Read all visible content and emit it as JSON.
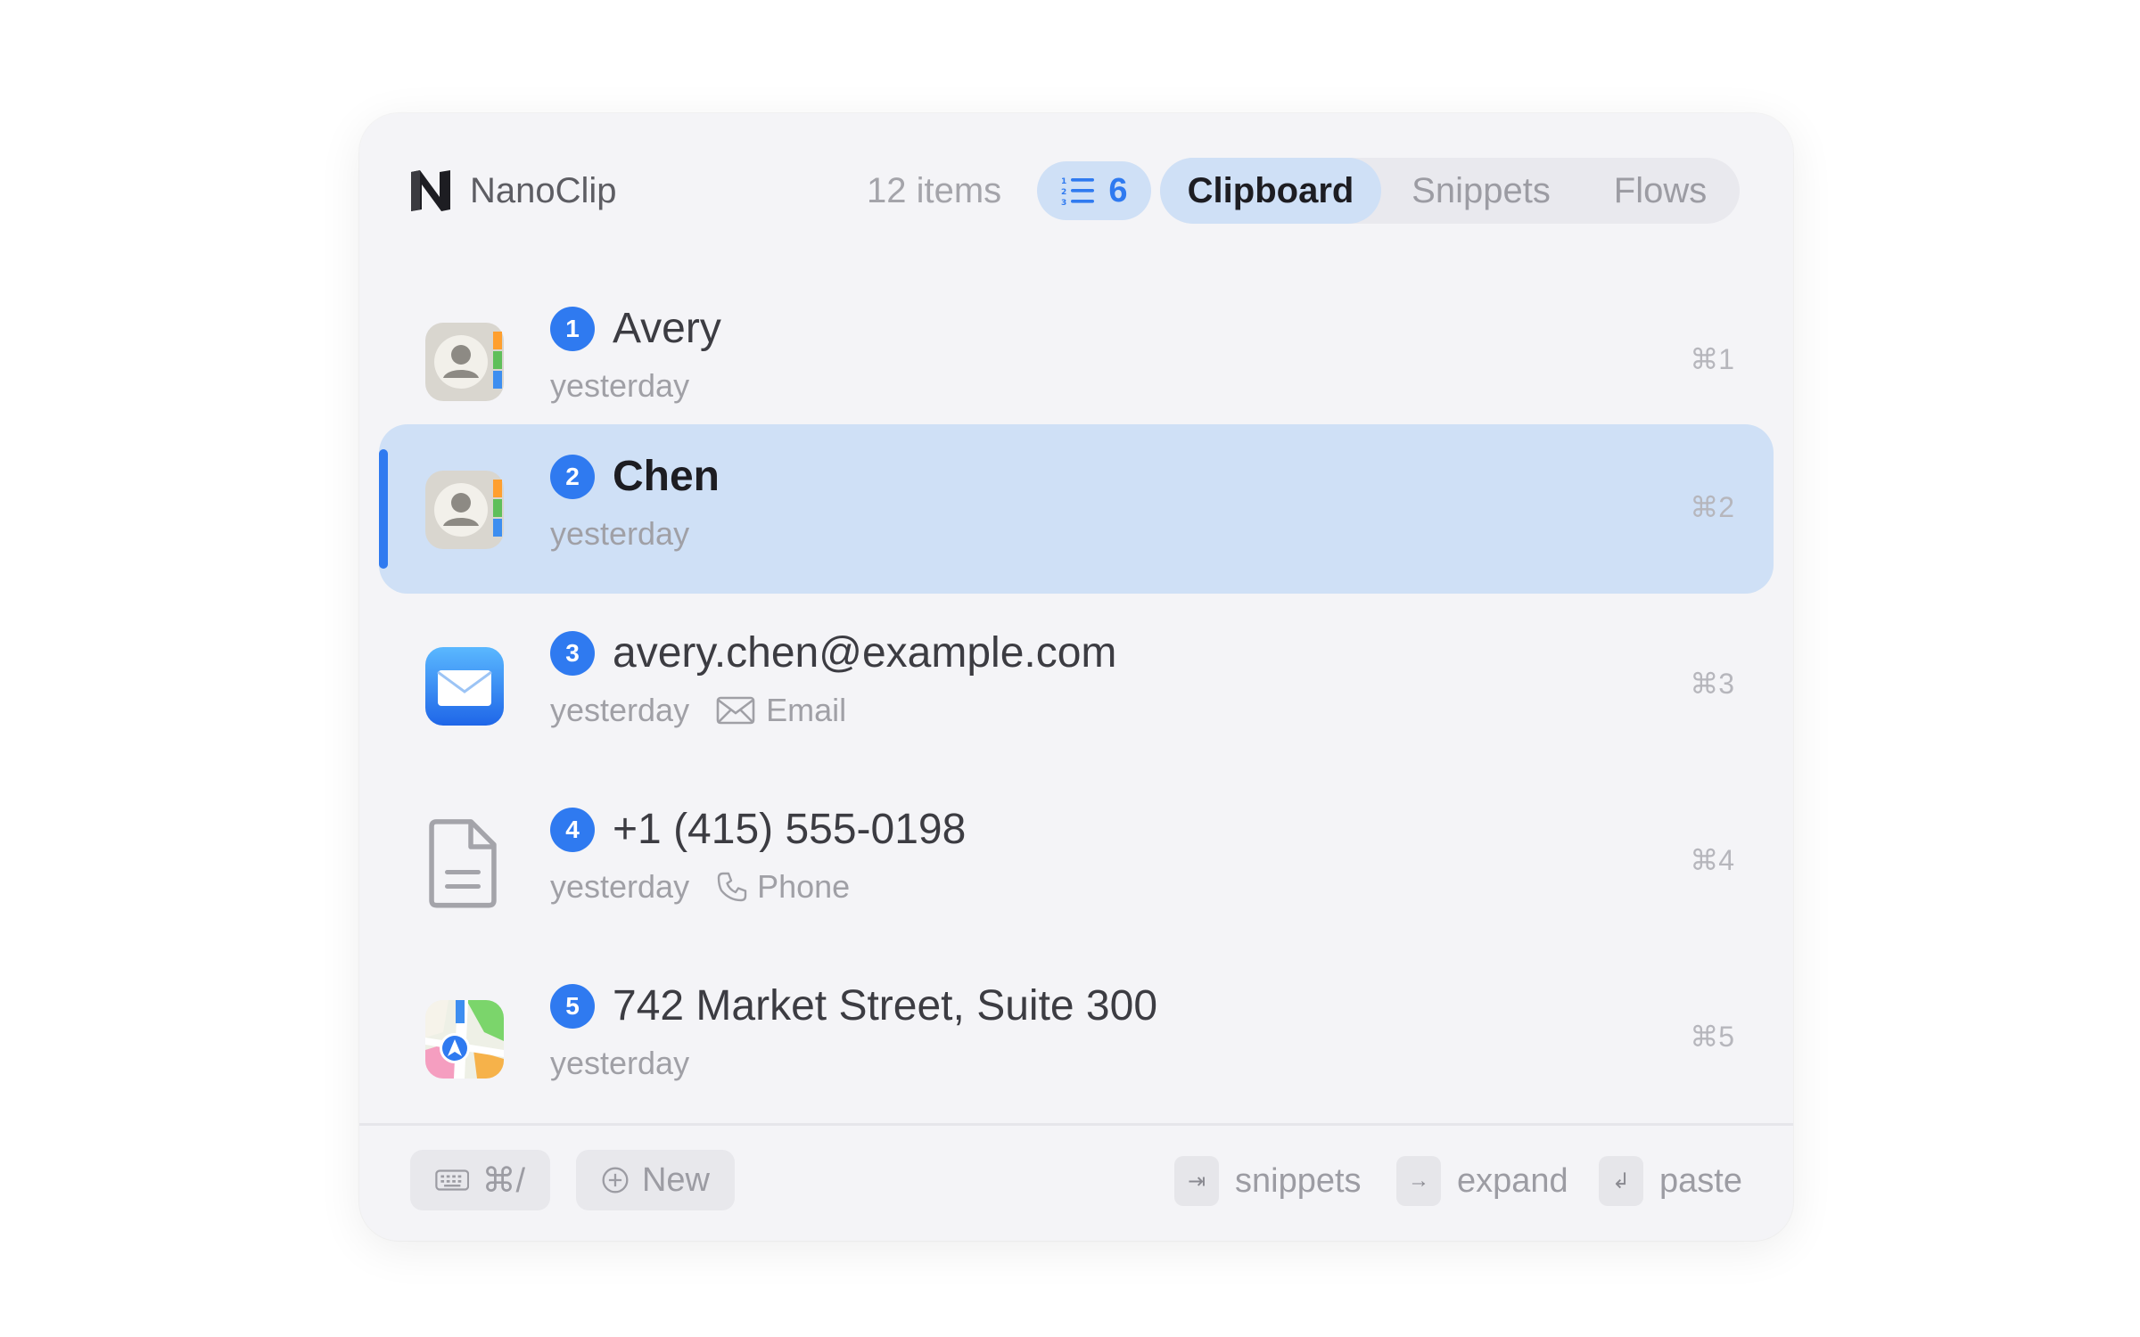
{
  "app": {
    "name": "NanoClip"
  },
  "header": {
    "item_count": "12 items",
    "queue_count": "6",
    "tabs": [
      {
        "label": "Clipboard",
        "active": true
      },
      {
        "label": "Snippets",
        "active": false
      },
      {
        "label": "Flows",
        "active": false
      }
    ]
  },
  "items": [
    {
      "index": "1",
      "title": "Avery",
      "time": "yesterday",
      "type_label": "",
      "shortcut": "⌘1",
      "icon": "contacts-app-icon",
      "selected": false
    },
    {
      "index": "2",
      "title": "Chen",
      "time": "yesterday",
      "type_label": "",
      "shortcut": "⌘2",
      "icon": "contacts-app-icon",
      "selected": true
    },
    {
      "index": "3",
      "title": "avery.chen@example.com",
      "time": "yesterday",
      "type_label": "Email",
      "type_icon": "envelope-icon",
      "shortcut": "⌘3",
      "icon": "mail-app-icon",
      "selected": false
    },
    {
      "index": "4",
      "title": "+1 (415) 555-0198",
      "time": "yesterday",
      "type_label": "Phone",
      "type_icon": "phone-icon",
      "shortcut": "⌘4",
      "icon": "document-icon",
      "selected": false
    },
    {
      "index": "5",
      "title": "742 Market Street, Suite 300",
      "time": "yesterday",
      "type_label": "",
      "shortcut": "⌘5",
      "icon": "maps-app-icon",
      "selected": false
    }
  ],
  "footer": {
    "keyboard_shortcut": "⌘/",
    "new_label": "New",
    "hints": [
      {
        "key": "⇥",
        "label": "snippets"
      },
      {
        "key": "→",
        "label": "expand"
      },
      {
        "key": "↲",
        "label": "paste"
      }
    ]
  },
  "colors": {
    "accent": "#2f7af0",
    "selected_row": "#cfe0f6",
    "window_bg": "#f4f4f7"
  }
}
